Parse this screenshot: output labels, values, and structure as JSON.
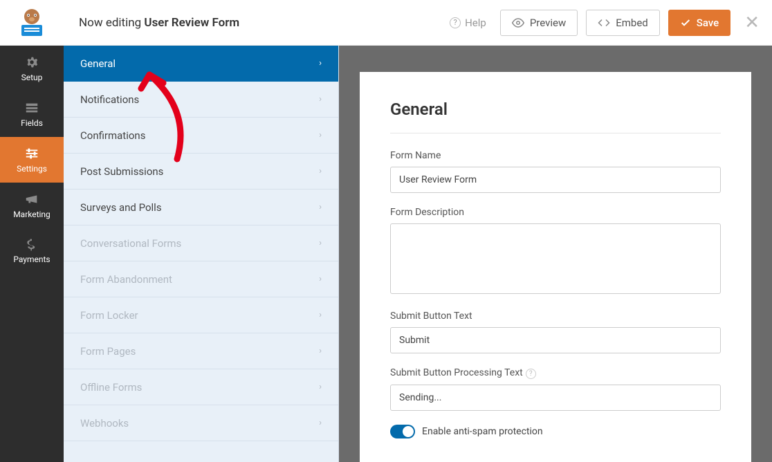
{
  "header": {
    "editing_prefix": "Now editing ",
    "form_name": "User Review Form",
    "help": "Help",
    "preview": "Preview",
    "embed": "Embed",
    "save": "Save"
  },
  "leftnav": {
    "setup": "Setup",
    "fields": "Fields",
    "settings": "Settings",
    "marketing": "Marketing",
    "payments": "Payments"
  },
  "settings_menu": [
    {
      "label": "General",
      "state": "active"
    },
    {
      "label": "Notifications",
      "state": ""
    },
    {
      "label": "Confirmations",
      "state": ""
    },
    {
      "label": "Post Submissions",
      "state": ""
    },
    {
      "label": "Surveys and Polls",
      "state": ""
    },
    {
      "label": "Conversational Forms",
      "state": "disabled"
    },
    {
      "label": "Form Abandonment",
      "state": "disabled"
    },
    {
      "label": "Form Locker",
      "state": "disabled"
    },
    {
      "label": "Form Pages",
      "state": "disabled"
    },
    {
      "label": "Offline Forms",
      "state": "disabled"
    },
    {
      "label": "Webhooks",
      "state": "disabled"
    }
  ],
  "panel": {
    "title": "General",
    "form_name_label": "Form Name",
    "form_name_value": "User Review Form",
    "form_desc_label": "Form Description",
    "form_desc_value": "",
    "submit_btn_label": "Submit Button Text",
    "submit_btn_value": "Submit",
    "submit_proc_label": "Submit Button Processing Text",
    "submit_proc_value": "Sending...",
    "antispam_label": "Enable anti-spam protection"
  }
}
